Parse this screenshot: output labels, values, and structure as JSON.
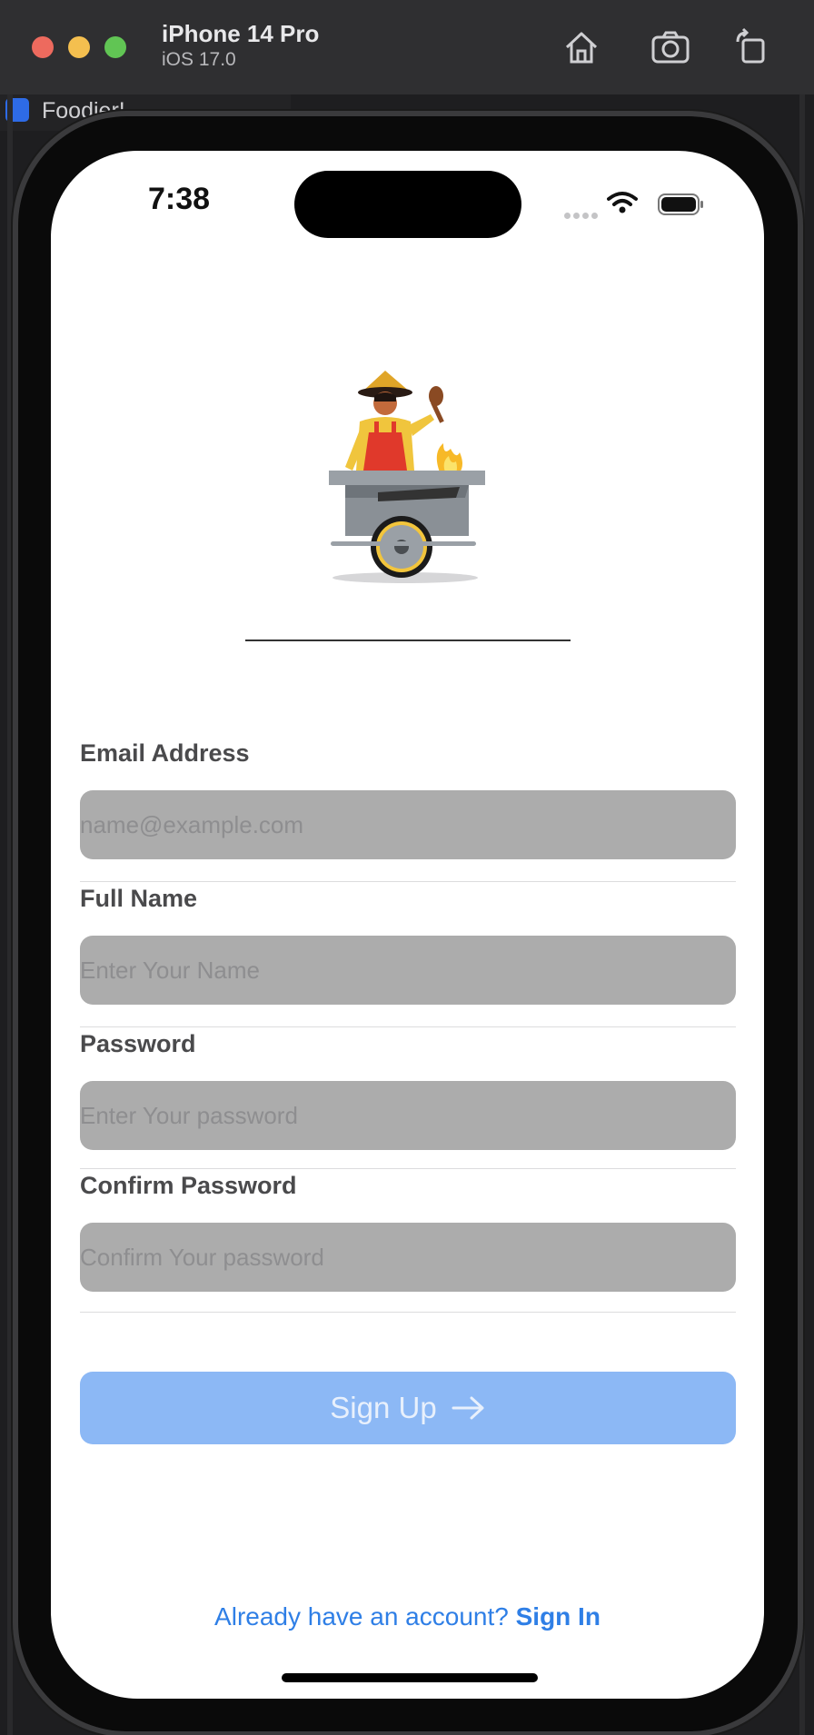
{
  "simulator": {
    "device_name": "iPhone 14 Pro",
    "os_version": "iOS 17.0",
    "home_icon": "home-icon",
    "screenshot_icon": "camera-icon",
    "rotate_icon": "rotate-icon"
  },
  "xcode": {
    "project_name": "Foodier!"
  },
  "status_bar": {
    "time": "7:38"
  },
  "form": {
    "email": {
      "label": "Email Address",
      "placeholder": "name@example.com",
      "value": ""
    },
    "full_name": {
      "label": "Full Name",
      "placeholder": "Enter Your Name",
      "value": ""
    },
    "password": {
      "label": "Password",
      "placeholder": "Enter Your password",
      "value": ""
    },
    "confirm_password": {
      "label": "Confirm Password",
      "placeholder": "Confirm Your password",
      "value": ""
    }
  },
  "signup_button": {
    "label": "Sign Up",
    "icon": "arrow-right-icon"
  },
  "footer": {
    "prompt": "Already have an account?",
    "link": "Sign In"
  },
  "colors": {
    "accent": "#2f7fe6",
    "button_disabled": "#8cb8f5",
    "field_bg": "#acacac"
  }
}
